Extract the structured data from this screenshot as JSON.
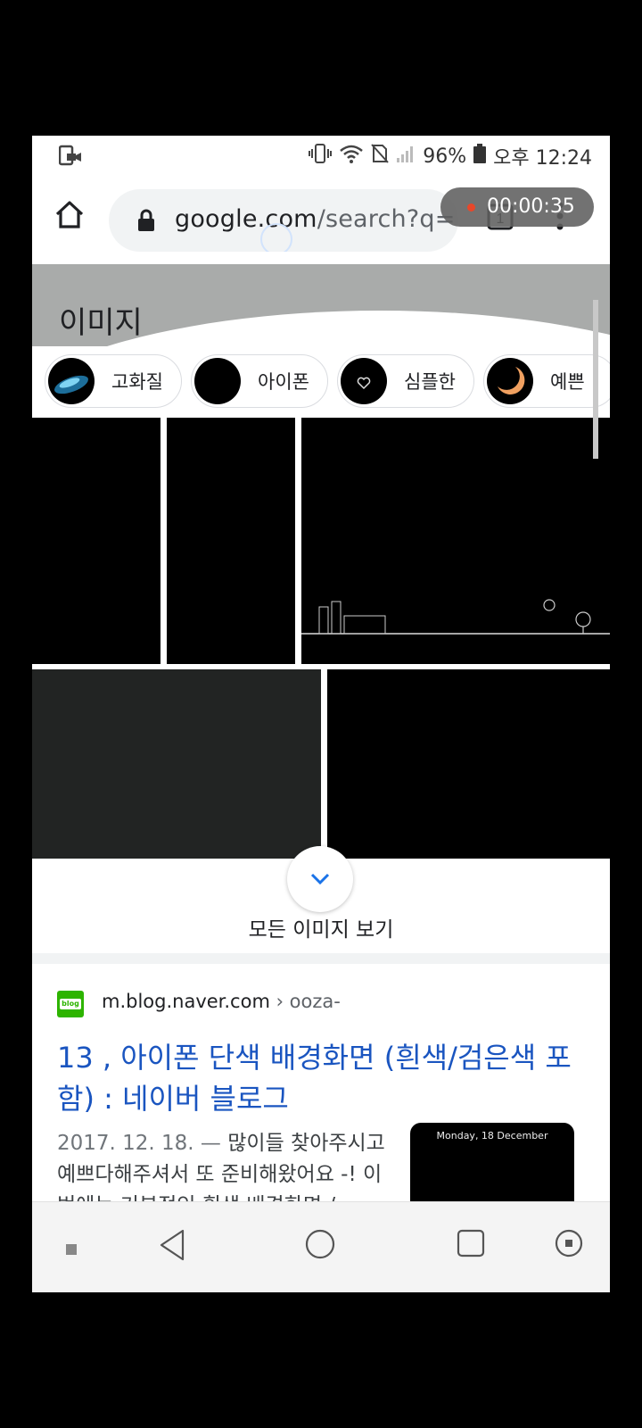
{
  "status_bar": {
    "battery": "96%",
    "time": "오후 12:24"
  },
  "browser": {
    "url_host": "google.com",
    "url_rest": "/search?q=",
    "tab_count": "1",
    "recording_time": "00:00:35"
  },
  "images_section": {
    "title": "이미지",
    "chips": [
      {
        "label": "고화질"
      },
      {
        "label": "아이폰"
      },
      {
        "label": "심플한"
      },
      {
        "label": "예쁜"
      }
    ],
    "see_all": "모든 이미지 보기"
  },
  "result": {
    "favicon_text": "blog",
    "site": "m.blog.naver.com",
    "crumb": " › ooza-",
    "title": "13 , 아이폰 단색 배경화면 (흰색/검은색 포함) : 네이버 블로그",
    "date": "2017. 12. 18. — ",
    "snippet": "많이들 찾아주시고 예쁘다해주셔서 또 준비해왔어요 -! 이번에는 기본적인 흰색 배경화면 /",
    "thumbnail_caption": "Monday, 18 December"
  },
  "colors": {
    "link": "#1a55c0",
    "record_dot": "#e8472a",
    "naver_green": "#2db400"
  }
}
